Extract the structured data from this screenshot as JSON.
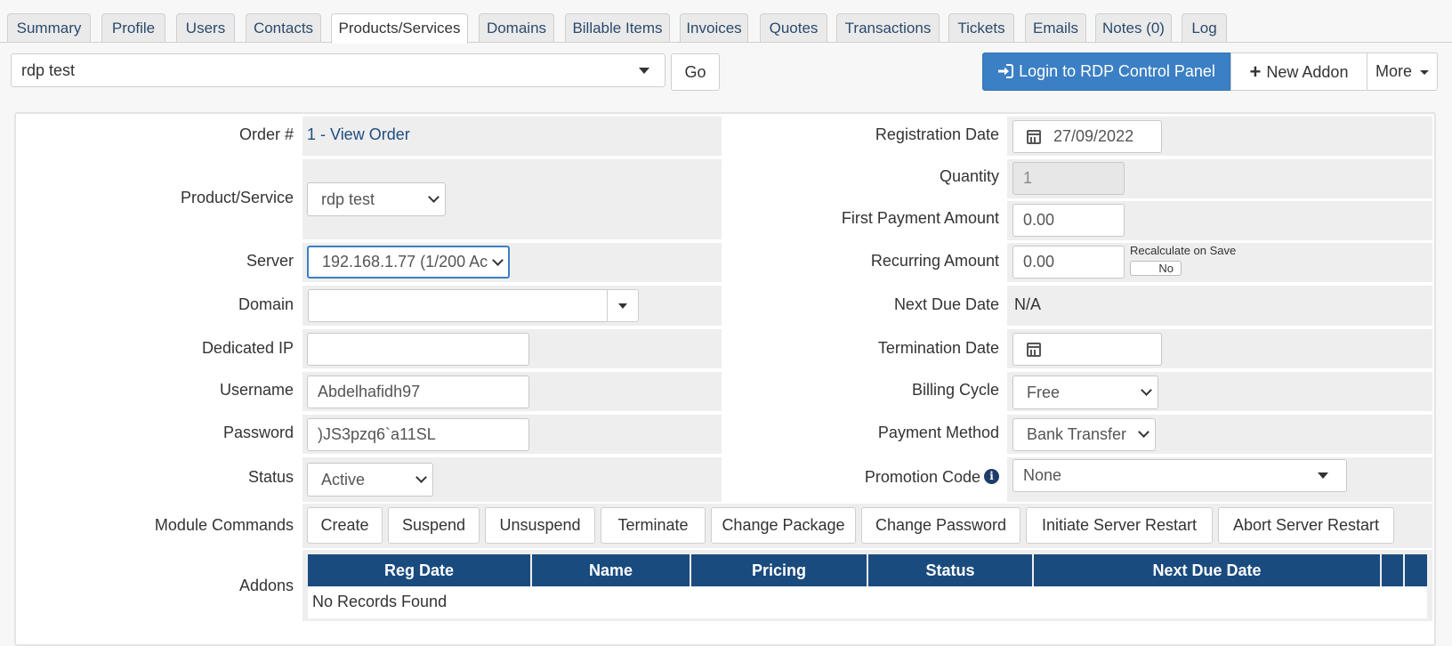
{
  "tabs": [
    "Summary",
    "Profile",
    "Users",
    "Contacts",
    "Products/Services",
    "Domains",
    "Billable Items",
    "Invoices",
    "Quotes",
    "Transactions",
    "Tickets",
    "Emails",
    "Notes (0)",
    "Log"
  ],
  "topbar": {
    "service_value": "rdp test",
    "go_label": "Go",
    "login_label": "Login to RDP Control Panel",
    "addon_label": "New Addon",
    "more_label": "More"
  },
  "left": {
    "order_label": "Order #",
    "order_value": "1 - View Order",
    "product_label": "Product/Service",
    "product_value": "rdp test",
    "server_label": "Server",
    "server_value": "192.168.1.77 (1/200 Ac",
    "domain_label": "Domain",
    "domain_value": "",
    "dedicated_ip_label": "Dedicated IP",
    "dedicated_ip_value": "",
    "username_label": "Username",
    "username_value": "Abdelhafidh97",
    "password_label": "Password",
    "password_value": ")JS3pzq6`a11SL",
    "status_label": "Status",
    "status_value": "Active"
  },
  "right": {
    "reg_date_label": "Registration Date",
    "reg_date_value": "27/09/2022",
    "quantity_label": "Quantity",
    "quantity_value": "1",
    "first_payment_label": "First Payment Amount",
    "first_payment_value": "0.00",
    "recurring_label": "Recurring Amount",
    "recurring_value": "0.00",
    "recalc_label": "Recalculate on Save",
    "recalc_toggle": "No",
    "next_due_label": "Next Due Date",
    "next_due_value": "N/A",
    "termination_label": "Termination Date",
    "termination_value": "",
    "billing_cycle_label": "Billing Cycle",
    "billing_cycle_value": "Free",
    "payment_method_label": "Payment Method",
    "payment_method_value": "Bank Transfer",
    "promo_label": "Promotion Code",
    "promo_value": "None"
  },
  "module": {
    "label": "Module Commands",
    "commands": [
      "Create",
      "Suspend",
      "Unsuspend",
      "Terminate",
      "Change Package",
      "Change Password",
      "Initiate Server Restart",
      "Abort Server Restart"
    ]
  },
  "addons": {
    "label": "Addons",
    "headers": [
      "Reg Date",
      "Name",
      "Pricing",
      "Status",
      "Next Due Date"
    ],
    "empty_text": "No Records Found"
  }
}
